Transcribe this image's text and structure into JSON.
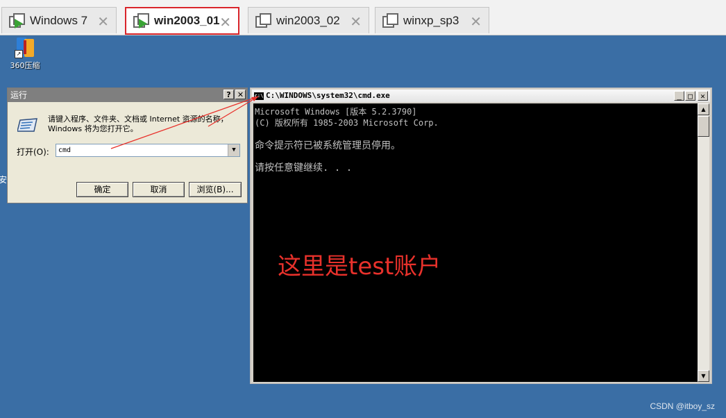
{
  "tabs": [
    {
      "label": "Windows 7",
      "active": false
    },
    {
      "label": "win2003_01",
      "active": true
    },
    {
      "label": "win2003_02",
      "active": false
    },
    {
      "label": "winxp_sp3",
      "active": false
    }
  ],
  "tab_close_glyph": "✕",
  "desktop": {
    "icon_label": "360压缩",
    "edge_char": "安"
  },
  "run_dialog": {
    "title": "运行",
    "help_glyph": "?",
    "close_glyph": "✕",
    "description": "请键入程序、文件夹、文档或 Internet 资源的名称，Windows 将为您打开它。",
    "open_label": "打开(O):",
    "input_value": "cmd",
    "ok_label": "确定",
    "cancel_label": "取消",
    "browse_label": "浏览(B)..."
  },
  "cmd_window": {
    "title": "C:\\WINDOWS\\system32\\cmd.exe",
    "icon_text": "c:\\",
    "min_glyph": "_",
    "max_glyph": "□",
    "close_glyph": "✕",
    "lines": [
      "Microsoft Windows [版本 5.2.3790]",
      "(C) 版权所有 1985-2003 Microsoft Corp.",
      "命令提示符已被系统管理员停用。",
      "请按任意键继续. . ."
    ]
  },
  "annotation": "这里是test账户",
  "watermark": "CSDN @itboy_sz",
  "colors": {
    "desktop_bg": "#3a6ea5",
    "active_tab_border": "#d9252b",
    "annotation": "#e8312b"
  }
}
